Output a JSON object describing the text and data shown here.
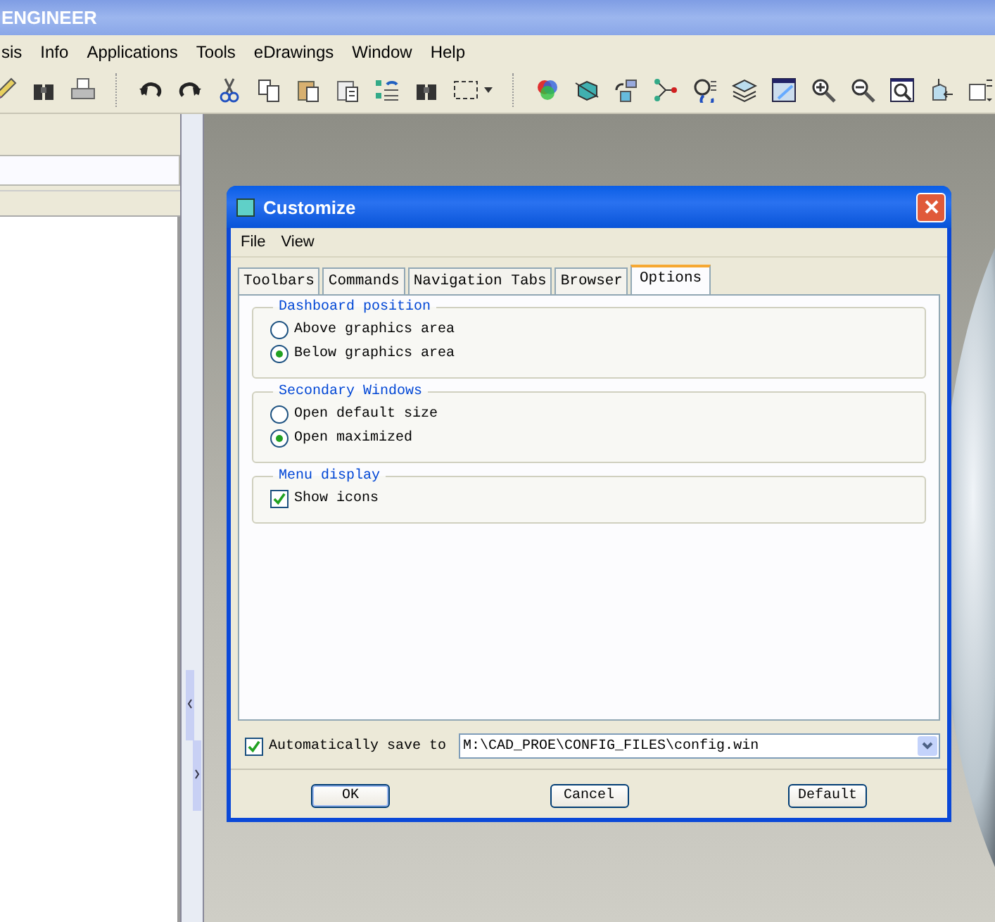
{
  "app": {
    "title": "ENGINEER",
    "menu": [
      "sis",
      "Info",
      "Applications",
      "Tools",
      "eDrawings",
      "Window",
      "Help"
    ]
  },
  "dialog": {
    "title": "Customize",
    "menu": [
      "File",
      "View"
    ],
    "tabs": [
      {
        "label": "Toolbars",
        "selected": false
      },
      {
        "label": "Commands",
        "selected": false
      },
      {
        "label": "Navigation Tabs",
        "selected": false
      },
      {
        "label": "Browser",
        "selected": false
      },
      {
        "label": "Options",
        "selected": true
      }
    ],
    "groups": [
      {
        "title": "Dashboard position",
        "options": [
          {
            "kind": "radio",
            "label": "Above graphics area",
            "selected": false
          },
          {
            "kind": "radio",
            "label": "Below graphics area",
            "selected": true
          }
        ]
      },
      {
        "title": "Secondary Windows",
        "options": [
          {
            "kind": "radio",
            "label": "Open default size",
            "selected": false
          },
          {
            "kind": "radio",
            "label": "Open maximized",
            "selected": true
          }
        ]
      },
      {
        "title": "Menu display",
        "options": [
          {
            "kind": "checkbox",
            "label": "Show icons",
            "checked": true
          }
        ]
      }
    ],
    "autosave": {
      "label": "Automatically save to",
      "checked": true,
      "value": "M:\\CAD_PROE\\CONFIG_FILES\\config.win"
    },
    "buttons": [
      "OK",
      "Cancel",
      "Default"
    ]
  }
}
